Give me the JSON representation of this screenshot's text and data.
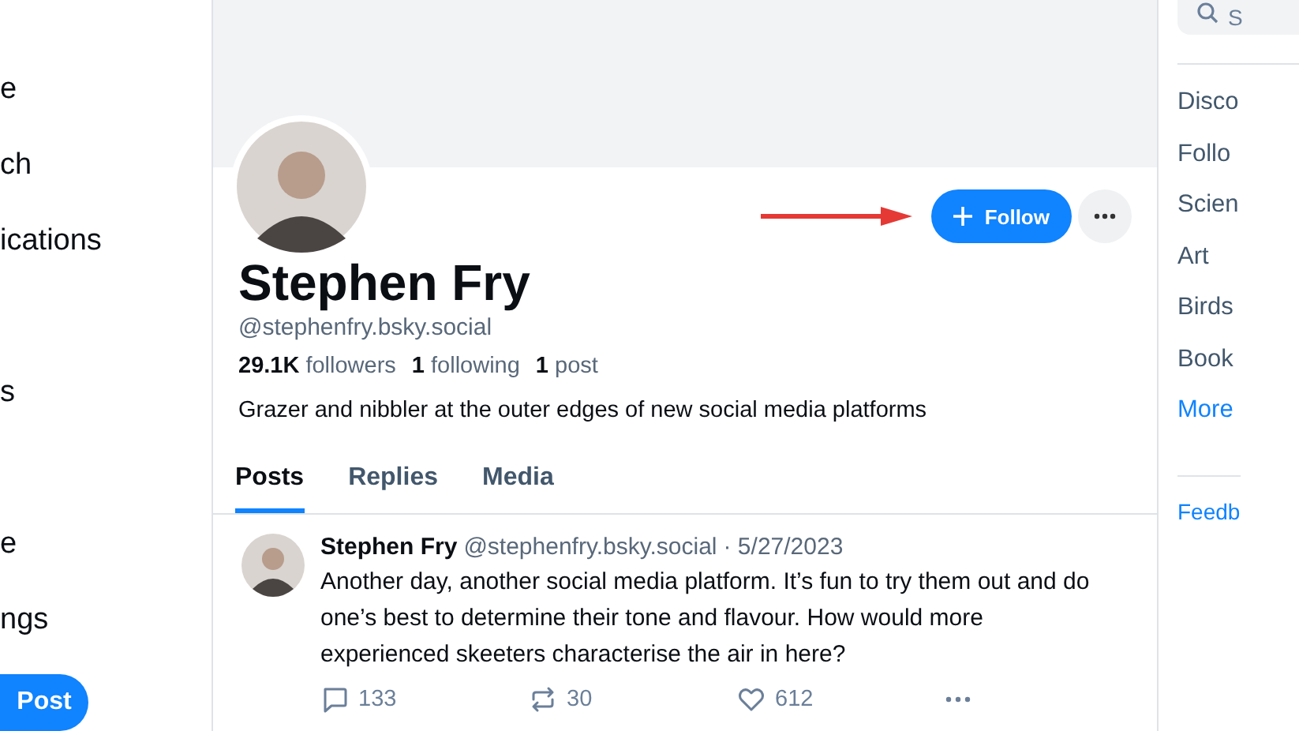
{
  "left_nav": {
    "items": [
      {
        "label": "e",
        "gap_before": false
      },
      {
        "label": "ch",
        "gap_before": false
      },
      {
        "label": "ications",
        "gap_before": false
      },
      {
        "label": "s",
        "gap_before": true
      },
      {
        "label": "e",
        "gap_before": true
      },
      {
        "label": "ngs",
        "gap_before": false
      }
    ],
    "post_button": {
      "label": "Post"
    }
  },
  "profile": {
    "name": "Stephen Fry",
    "handle": "@stephenfry.bsky.social",
    "stats": [
      {
        "count": "29.1K",
        "label": "followers"
      },
      {
        "count": "1",
        "label": "following"
      },
      {
        "count": "1",
        "label": "post"
      }
    ],
    "bio": "Grazer and nibbler at the outer edges of new social media platforms",
    "follow_button": {
      "label": "Follow"
    }
  },
  "tabs": [
    {
      "label": "Posts",
      "selected": true
    },
    {
      "label": "Replies",
      "selected": false
    },
    {
      "label": "Media",
      "selected": false
    }
  ],
  "posts": [
    {
      "author": "Stephen Fry",
      "handle": "@stephenfry.bsky.social",
      "date": "· 5/27/2023",
      "text": "Another day, another social media platform. It’s fun to try them out and do one’s best to determine their tone and flavour. How would more experienced skeeters characterise the air in here?",
      "replies": "133",
      "reposts": "30",
      "likes": "612"
    }
  ],
  "right_sidebar": {
    "search": {
      "placeholder": "S"
    },
    "feeds": [
      {
        "label": "Disco",
        "kind": "feed"
      },
      {
        "label": "Follo",
        "kind": "feed"
      },
      {
        "label": "Scien",
        "kind": "feed"
      },
      {
        "label": "Art",
        "kind": "feed"
      },
      {
        "label": "Birds",
        "kind": "feed"
      },
      {
        "label": "Book",
        "kind": "feed"
      },
      {
        "label": "More",
        "kind": "link"
      }
    ],
    "feedback": {
      "label": "Feedb"
    }
  }
}
